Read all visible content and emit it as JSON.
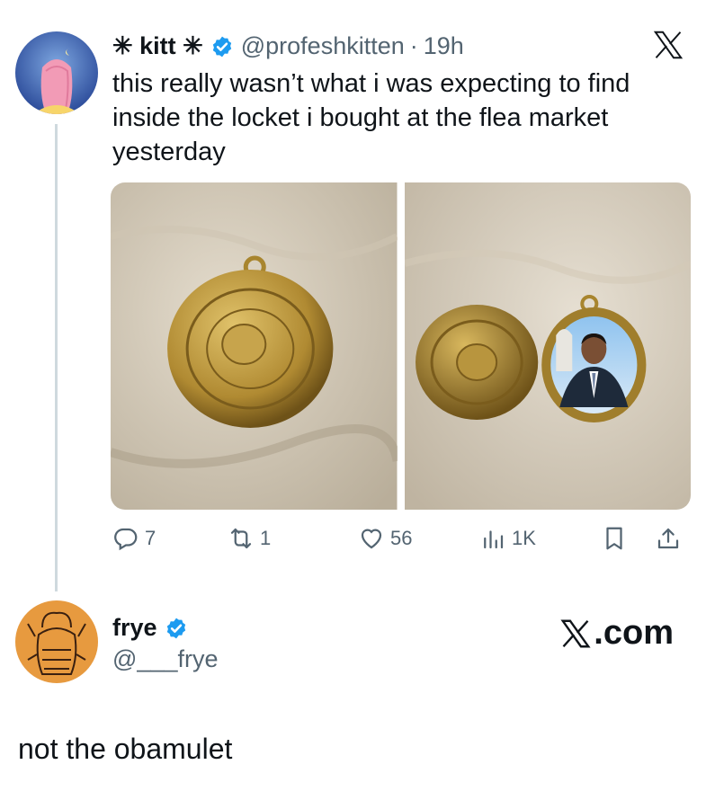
{
  "tweet": {
    "display_name": "✳ kitt ✳",
    "verified_icon": "verified-badge-icon",
    "handle": "@profeshkitten",
    "separator": "·",
    "time": "19h",
    "text": "this really wasn’t what i was expecting to find inside the locket i bought at the flea market yesterday",
    "images": [
      {
        "name": "closed-locket-photo"
      },
      {
        "name": "open-locket-photo"
      }
    ],
    "actions": {
      "replies": "7",
      "reposts": "1",
      "likes": "56",
      "views": "1K"
    }
  },
  "reply": {
    "display_name": "frye",
    "handle": "@___frye",
    "brand": ".com",
    "text": "not the obamulet"
  },
  "colors": {
    "verified": "#1d9bf0",
    "secondary_text": "#536471",
    "thread_line": "#cfd9de"
  }
}
